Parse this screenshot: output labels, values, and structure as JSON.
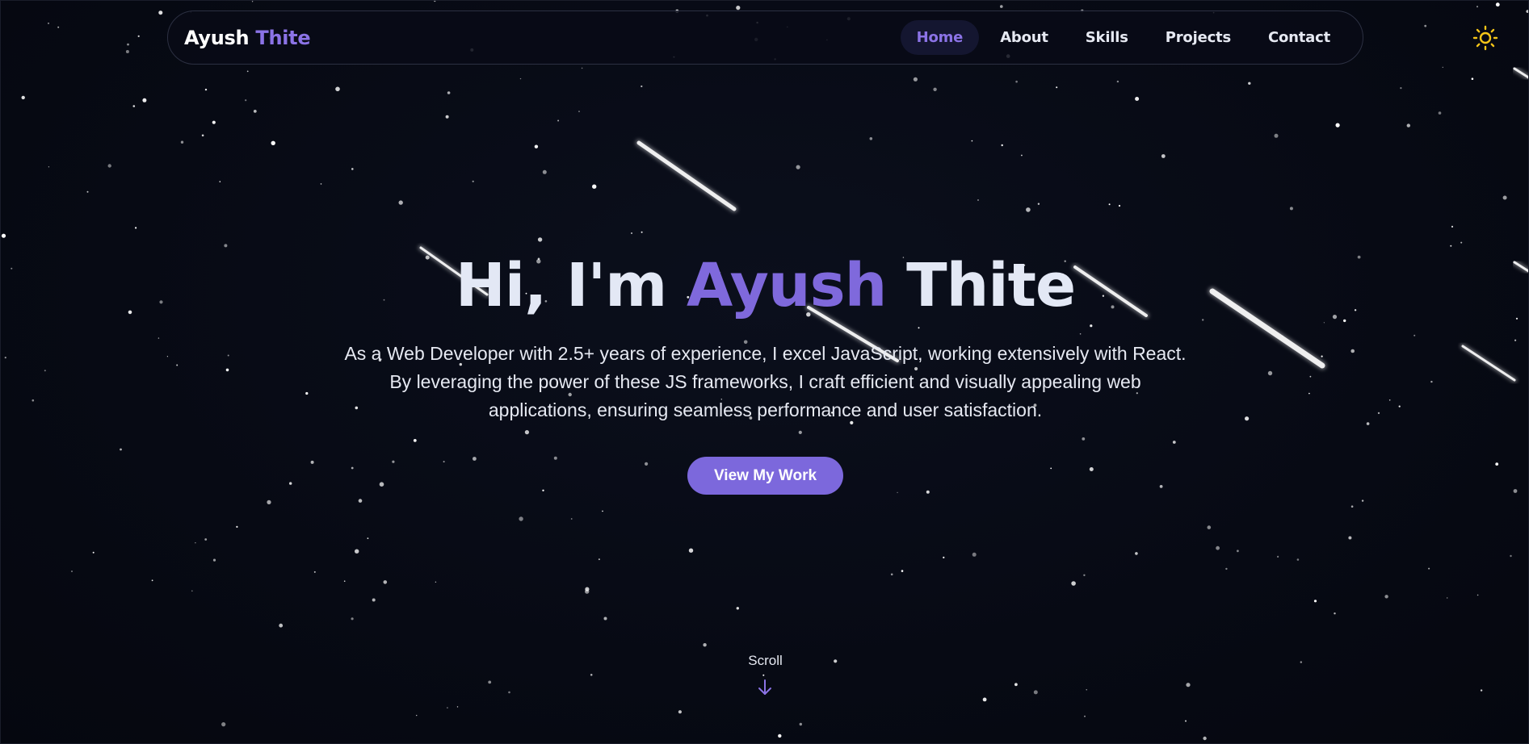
{
  "header": {
    "logo_first": "Ayush",
    "logo_last": "Thite",
    "nav": [
      {
        "label": "Home",
        "active": true
      },
      {
        "label": "About",
        "active": false
      },
      {
        "label": "Skills",
        "active": false
      },
      {
        "label": "Projects",
        "active": false
      },
      {
        "label": "Contact",
        "active": false
      }
    ],
    "theme_icon": "sun-icon"
  },
  "hero": {
    "greeting": "Hi, I'm",
    "first_name": "Ayush",
    "last_name": "Thite",
    "description": "As a Web Developer with 2.5+ years of experience, I excel JavaScript, working extensively with React. By leveraging the power of these JS frameworks, I craft efficient and visually appealing web applications, ensuring seamless performance and user satisfaction.",
    "cta_label": "View My Work"
  },
  "scroll": {
    "label": "Scroll",
    "icon": "arrow-down-icon"
  },
  "colors": {
    "background": "#070a14",
    "accent": "#7c68dc",
    "text": "#e6e9f2",
    "sun": "#f5c518"
  }
}
